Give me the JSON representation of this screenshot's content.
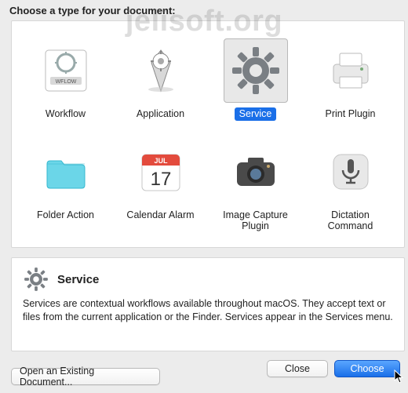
{
  "watermark": "jelisoft.org",
  "prompt": "Choose a type for your document:",
  "types": [
    {
      "id": "workflow",
      "label": "Workflow",
      "icon": "workflow"
    },
    {
      "id": "application",
      "label": "Application",
      "icon": "application"
    },
    {
      "id": "service",
      "label": "Service",
      "icon": "service"
    },
    {
      "id": "print-plugin",
      "label": "Print Plugin",
      "icon": "print-plugin"
    },
    {
      "id": "folder-action",
      "label": "Folder Action",
      "icon": "folder-action"
    },
    {
      "id": "calendar-alarm",
      "label": "Calendar Alarm",
      "icon": "calendar-alarm"
    },
    {
      "id": "image-capture",
      "label": "Image Capture Plugin",
      "icon": "image-capture"
    },
    {
      "id": "dictation",
      "label": "Dictation Command",
      "icon": "dictation"
    }
  ],
  "selected_type": "service",
  "calendar": {
    "month": "JUL",
    "day": "17"
  },
  "description": {
    "title": "Service",
    "body": "Services are contextual workflows available throughout macOS. They accept text or files from the current application or the Finder. Services appear in the Services menu."
  },
  "buttons": {
    "open": "Open an Existing Document...",
    "close": "Close",
    "choose": "Choose"
  },
  "colors": {
    "accent": "#1a6fe8",
    "panel_bg": "#ffffff",
    "window_bg": "#ececec"
  }
}
